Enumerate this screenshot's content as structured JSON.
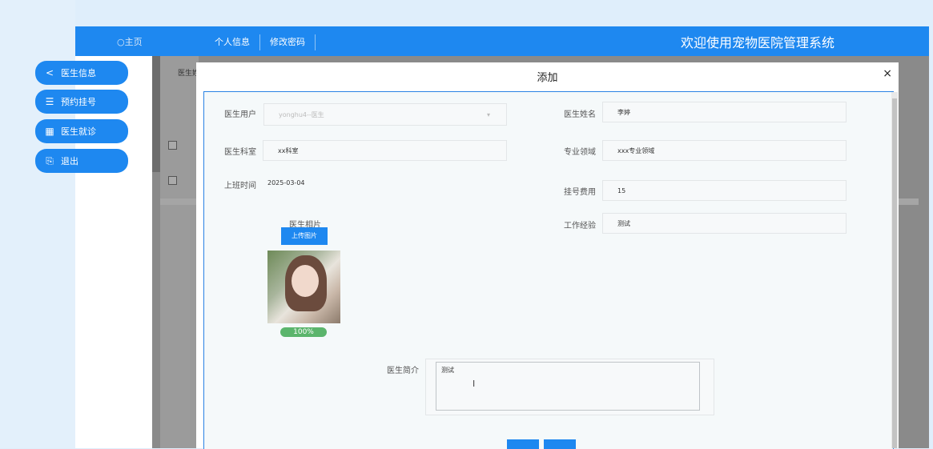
{
  "header": {
    "home_label": "主页",
    "nav": [
      "个人信息",
      "修改密码"
    ],
    "title": "欢迎使用宠物医院管理系统"
  },
  "sidebar": {
    "items": [
      {
        "label": "医生信息",
        "icon": "share-icon"
      },
      {
        "label": "预约挂号",
        "icon": "list-icon"
      },
      {
        "label": "医生就诊",
        "icon": "grid-icon"
      },
      {
        "label": "退出",
        "icon": "exit-icon"
      }
    ]
  },
  "background": {
    "column_label": "医生姓"
  },
  "modal": {
    "title": "添加",
    "close_label": "×",
    "fields": {
      "doctor_user": {
        "label": "医生用户",
        "value": "yonghu4--医生"
      },
      "doctor_name": {
        "label": "医生姓名",
        "value": "李婷"
      },
      "department": {
        "label": "医生科室",
        "value": "xx科室"
      },
      "specialty": {
        "label": "专业领域",
        "value": "xxx专业领域"
      },
      "work_time": {
        "label": "上班时间",
        "value": "2025-03-04"
      },
      "fee": {
        "label": "挂号费用",
        "value": "15"
      },
      "experience": {
        "label": "工作经验",
        "value": "测试"
      },
      "photo": {
        "label": "医生相片",
        "upload_label": "上传图片",
        "progress": "100%"
      },
      "intro": {
        "label": "医生简介",
        "value": "测试"
      }
    },
    "buttons": {
      "submit": "",
      "cancel": ""
    }
  },
  "colors": {
    "accent": "#1e88f0",
    "progress": "#5bb56c"
  }
}
